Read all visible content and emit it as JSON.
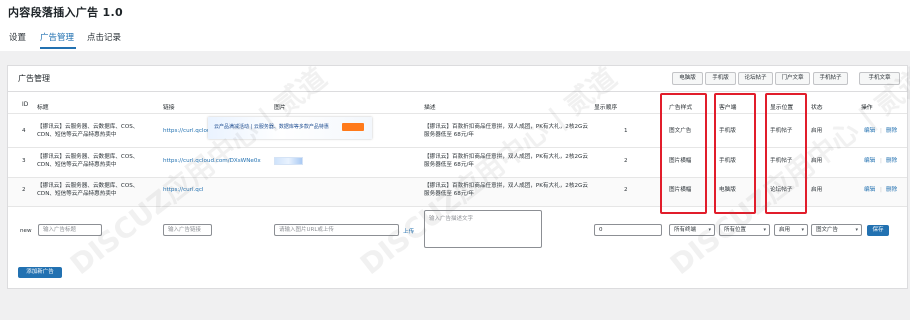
{
  "app": {
    "title": "内容段落插入广告 1.0"
  },
  "tabs": [
    {
      "label": "设置"
    },
    {
      "label": "广告管理"
    },
    {
      "label": "点击记录"
    }
  ],
  "panel": {
    "title": "广告管理"
  },
  "quick_buttons": [
    "电脑版",
    "手机版",
    "论坛帖子",
    "门户文章",
    "手机帖子",
    "手机文章"
  ],
  "table": {
    "headers": [
      "ID",
      "标题",
      "链接",
      "图片",
      "描述",
      "显示顺序",
      "广告样式",
      "客户端",
      "显示位置",
      "状态",
      "操作"
    ],
    "rows": [
      {
        "id": "4",
        "title": "【挪讯云】云服务器、云数据库、COS、CDN、短信等云产品特惠热卖中",
        "link": "https://curl.qcloud.com/DXsWNe0x",
        "desc": "【挪讯云】百款折扣商品任意拼，双人成团，PK有大礼，2核2G云服务器低至 68元/年",
        "order": "1",
        "style": "图文广告",
        "client": "手机版",
        "position": "手机帖子",
        "status": "启用",
        "edit": "编辑",
        "delete": "删除"
      },
      {
        "id": "3",
        "title": "【挪讯云】云服务器、云数据库、COS、CDN、短信等云产品特惠热卖中",
        "link": "https://curl.qcloud.com/DXsWNe0x",
        "desc": "【挪讯云】百款折扣商品任意拼，双人成团，PK有大礼，2核2G云服务器低至 68元/年",
        "order": "2",
        "style": "图片横幅",
        "client": "手机版",
        "position": "手机帖子",
        "status": "启用",
        "edit": "编辑",
        "delete": "删除"
      },
      {
        "id": "2",
        "title": "【挪讯云】云服务器、云数据库、COS、CDN、短信等云产品特惠热卖中",
        "link": "https://curl.qcl",
        "desc": "【挪讯云】百款折扣商品任意拼，双人成团，PK有大礼，2核2G云服务器低至 68元/年",
        "order": "2",
        "style": "图片横幅",
        "client": "电脑版",
        "position": "论坛帖子",
        "status": "启用",
        "edit": "编辑",
        "delete": "删除"
      }
    ],
    "preview_banner_text": "云产品满减活动 | 云服务器、数据库等多款产品特惠"
  },
  "new_row": {
    "label": "new",
    "title_placeholder": "输入广告标题",
    "link_placeholder": "输入广告链接",
    "image_placeholder": "请输入图片URL或上传",
    "upload_label": "上传",
    "desc_placeholder": "输入广告描述文字",
    "order_value": "0",
    "style_select": "所有终端",
    "position_select": "所有位置",
    "status_select": "启用",
    "type_select": "图文广告",
    "save_label": "保存"
  },
  "add_button": "添加新广告",
  "watermark": "DISCUZ应用中心 | 贰道"
}
